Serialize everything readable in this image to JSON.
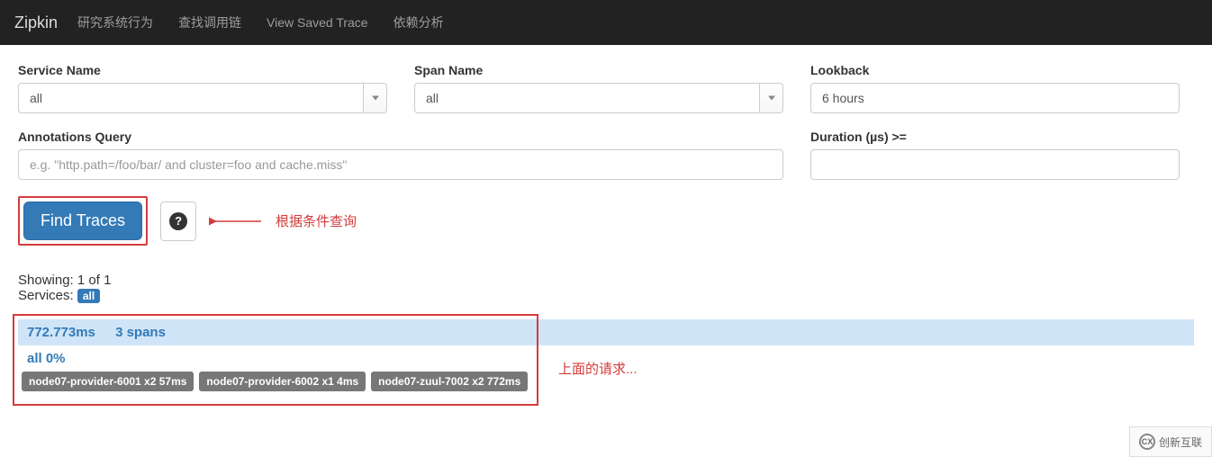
{
  "navbar": {
    "brand": "Zipkin",
    "items": [
      "研究系统行为",
      "查找调用链",
      "View Saved Trace",
      "依赖分析"
    ]
  },
  "form": {
    "serviceName": {
      "label": "Service Name",
      "value": "all"
    },
    "spanName": {
      "label": "Span Name",
      "value": "all"
    },
    "lookback": {
      "label": "Lookback",
      "value": "6 hours"
    },
    "annotationsQuery": {
      "label": "Annotations Query",
      "placeholder": "e.g. \"http.path=/foo/bar/ and cluster=foo and cache.miss\""
    },
    "duration": {
      "label": "Duration (µs) >="
    },
    "findButton": "Find Traces"
  },
  "annotations": {
    "findHint": "根据条件查询",
    "resultHint": "上面的请求..."
  },
  "summary": {
    "showingPrefix": "Showing: ",
    "shown": "1",
    "of": " of ",
    "total": "1",
    "servicesLabel": "Services: ",
    "servicesBadge": "all"
  },
  "result": {
    "duration": "772.773ms",
    "spans": "3 spans",
    "subline": "all 0%",
    "tags": [
      "node07-provider-6001 x2 57ms",
      "node07-provider-6002 x1 4ms",
      "node07-zuul-7002 x2 772ms"
    ]
  },
  "cornerLogo": "创新互联"
}
